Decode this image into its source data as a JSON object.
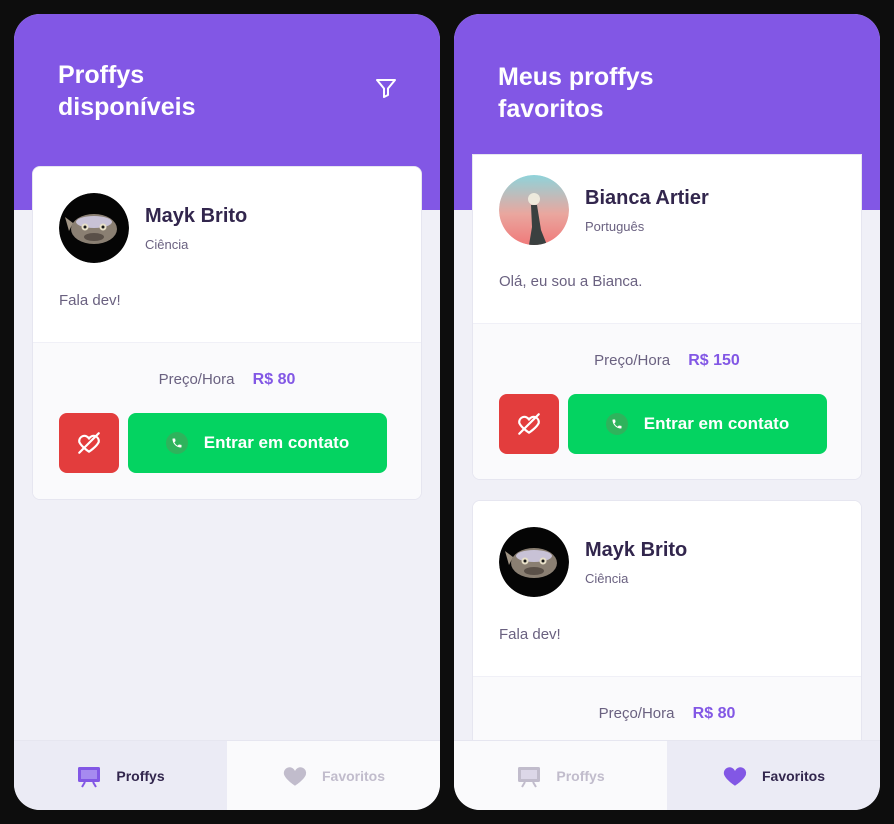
{
  "screens": {
    "left": {
      "title": "Proffys disponíveis",
      "card": {
        "name": "Mayk Brito",
        "subject": "Ciência",
        "bio": "Fala dev!",
        "price_label": "Preço/Hora",
        "price": "R$ 80",
        "contact_label": "Entrar em contato"
      },
      "tabs": [
        {
          "label": "Proffys",
          "active": true
        },
        {
          "label": "Favoritos",
          "active": false
        }
      ]
    },
    "right": {
      "title": "Meus proffys favoritos",
      "cards": [
        {
          "name": "Bianca Artier",
          "subject": "Português",
          "bio": "Olá, eu sou a Bianca.",
          "price_label": "Preço/Hora",
          "price": "R$ 150",
          "contact_label": "Entrar em contato"
        },
        {
          "name": "Mayk Brito",
          "subject": "Ciência",
          "bio": "Fala dev!",
          "price_label": "Preço/Hora",
          "price": "R$ 80"
        }
      ],
      "tabs": [
        {
          "label": "Proffys",
          "active": false
        },
        {
          "label": "Favoritos",
          "active": true
        }
      ]
    }
  },
  "colors": {
    "primary": "#8257e5",
    "background": "#f0f0f7",
    "danger": "#e33d3d",
    "success": "#04d361",
    "title_text": "#32264d"
  },
  "icons": [
    "filter-icon",
    "unfavorite-heart-icon",
    "whatsapp-icon",
    "tv-icon",
    "heart-icon"
  ]
}
